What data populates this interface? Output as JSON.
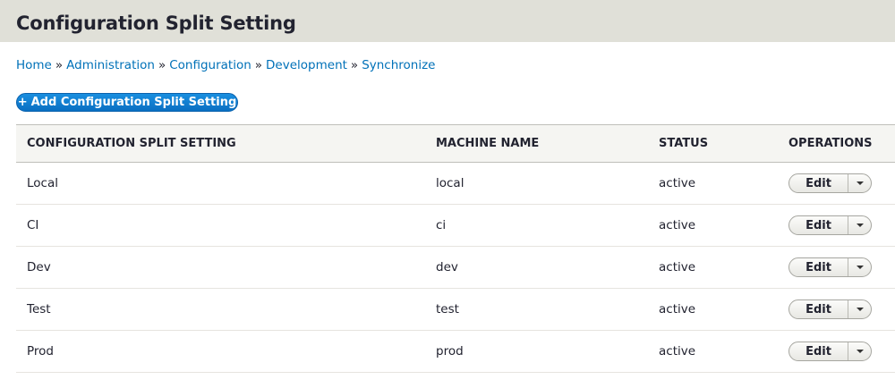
{
  "page": {
    "title": "Configuration Split Setting"
  },
  "breadcrumb": {
    "items": [
      "Home",
      "Administration",
      "Configuration",
      "Development",
      "Synchronize"
    ],
    "separator": "»"
  },
  "actions": {
    "add_label": "Add Configuration Split Setting",
    "add_prefix": "+"
  },
  "table": {
    "headers": [
      "CONFIGURATION SPLIT SETTING",
      "MACHINE NAME",
      "STATUS",
      "OPERATIONS"
    ],
    "rows": [
      {
        "name": "Local",
        "machine": "local",
        "status": "active",
        "op": "Edit"
      },
      {
        "name": "CI",
        "machine": "ci",
        "status": "active",
        "op": "Edit"
      },
      {
        "name": "Dev",
        "machine": "dev",
        "status": "active",
        "op": "Edit"
      },
      {
        "name": "Test",
        "machine": "test",
        "status": "active",
        "op": "Edit"
      },
      {
        "name": "Prod",
        "machine": "prod",
        "status": "active",
        "op": "Edit"
      }
    ]
  },
  "colors": {
    "link": "#0071b8",
    "primary_button": "#0a6fc2",
    "header_bg": "#e0e0d8"
  },
  "icons": {
    "dropbutton_toggle": "caret-down-icon"
  }
}
